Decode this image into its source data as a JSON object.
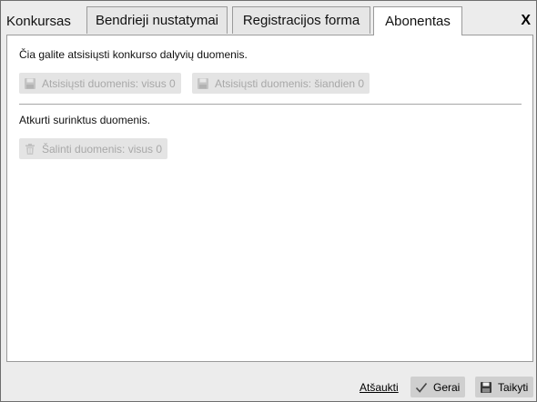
{
  "dialog": {
    "title": "Konkursas",
    "close_label": "X"
  },
  "tabs": [
    {
      "label": "Bendrieji nustatymai",
      "active": false
    },
    {
      "label": "Registracijos forma",
      "active": false
    },
    {
      "label": "Abonentas",
      "active": true
    }
  ],
  "download_section": {
    "description": "Čia galite atsisiųsti konkurso dalyvių duomenis.",
    "download_all_label": "Atsisiųsti duomenis: visus 0",
    "download_today_label": "Atsisiųsti duomenis: šiandien 0"
  },
  "delete_section": {
    "description": "Atkurti surinktus duomenis.",
    "delete_all_label": "Šalinti duomenis: visus 0"
  },
  "footer": {
    "cancel_label": "Atšaukti",
    "ok_label": "Gerai",
    "apply_label": "Taikyti"
  }
}
